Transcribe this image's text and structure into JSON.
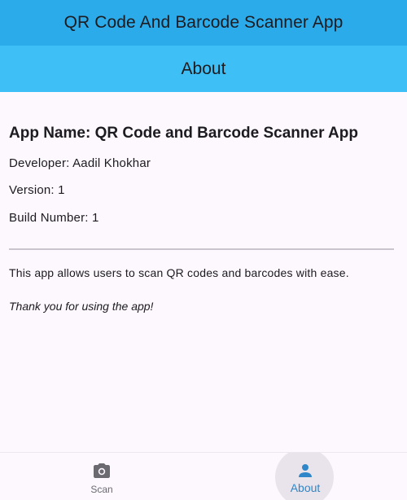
{
  "app_bar": {
    "title": "QR Code And Barcode Scanner App"
  },
  "page_header": {
    "title": "About"
  },
  "about": {
    "app_name": "App Name: QR Code and Barcode Scanner App",
    "developer": "Developer: Aadil Khokhar",
    "version": "Version: 1",
    "build_number": "Build Number: 1",
    "description": "This app allows users to scan QR codes and barcodes with ease.",
    "thanks": "Thank you for using the app!"
  },
  "bottom_nav": {
    "items": [
      {
        "label": "Scan",
        "icon": "camera-icon",
        "selected": false
      },
      {
        "label": "About",
        "icon": "person-icon",
        "selected": true
      }
    ]
  },
  "colors": {
    "app_bar": "#2cabea",
    "page_header": "#3ec0f6",
    "background": "#fdf7fe",
    "nav_selected": "#2f86c8",
    "nav_unselected": "#6b6a70"
  }
}
